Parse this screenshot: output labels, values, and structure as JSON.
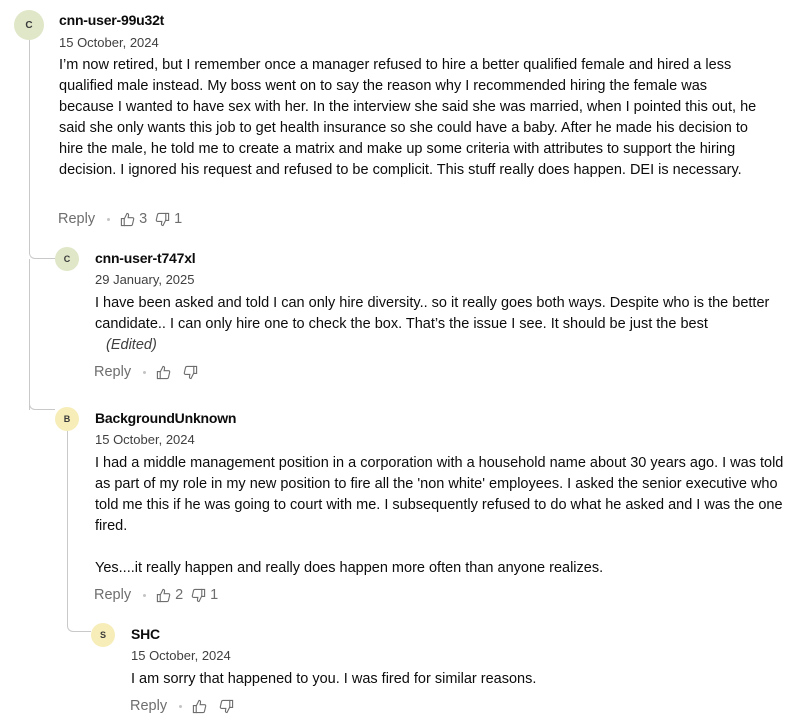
{
  "comments": [
    {
      "avatar_letter": "C",
      "avatar_color": "#dfe7c8",
      "username": "cnn-user-99u32t",
      "date": "15 October, 2024",
      "body": "I’m now retired, but I remember once a manager refused to hire a better qualified female and hired a less qualified male instead.  My boss went on to say the reason why I recommended hiring the female was because I wanted to have sex with her.  In the interview she said she was married, when I pointed this out, he said she only wants this job to get health insurance so she could have a baby.  After he made his decision to hire the male, he told me to create a matrix and make up some criteria with attributes to support the hiring decision.  I ignored his request and refused to be complicit.  This stuff really does happen. DEI is necessary.",
      "reply_label": "Reply",
      "likes": "3",
      "dislikes": "1"
    },
    {
      "avatar_letter": "C",
      "avatar_color": "#dfe7c8",
      "username": "cnn-user-t747xl",
      "date": "29 January, 2025",
      "body": "I have been asked and told I can only hire diversity.. so it really goes both ways. Despite who is the better candidate.. I can only hire one to check the box. That’s the issue I see. It should be just the best",
      "edited_label": "(Edited)",
      "reply_label": "Reply",
      "likes": "",
      "dislikes": ""
    },
    {
      "avatar_letter": "B",
      "avatar_color": "#f6edb8",
      "username": "BackgroundUnknown",
      "date": "15 October, 2024",
      "body": "I had a middle management position in a corporation with a household name about 30 years ago. I was told as part of my role in my new position to fire all the 'non white' employees. I asked the senior executive who told me this if he was going to court with me. I subsequently refused to do what he asked and I was the one fired.",
      "body_2": "Yes....it really happen and really does happen more often than anyone realizes.",
      "reply_label": "Reply",
      "likes": "2",
      "dislikes": "1"
    },
    {
      "avatar_letter": "S",
      "avatar_color": "#f6edb8",
      "username": "SHC",
      "date": "15 October, 2024",
      "body": "I am sorry that happened to you. I was fired for similar reasons.",
      "reply_label": "Reply",
      "likes": "",
      "dislikes": ""
    }
  ],
  "icons": {
    "like": "thumbs-up-icon",
    "dislike": "thumbs-down-icon"
  }
}
